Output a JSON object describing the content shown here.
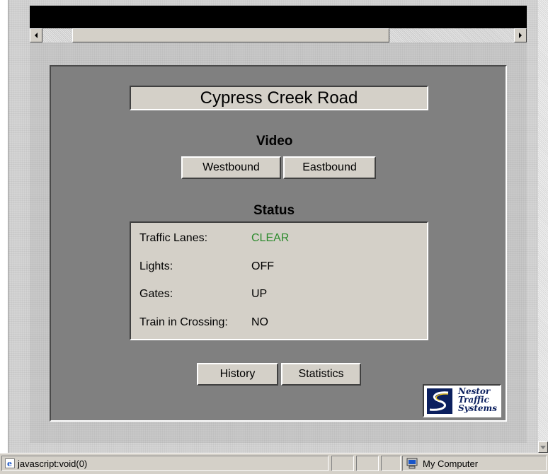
{
  "panel": {
    "title": "Cypress Creek Road",
    "video": {
      "heading": "Video",
      "westbound_label": "Westbound",
      "eastbound_label": "Eastbound"
    },
    "status": {
      "heading": "Status",
      "rows": [
        {
          "label": "Traffic Lanes:",
          "value": "CLEAR"
        },
        {
          "label": "Lights:",
          "value": "OFF"
        },
        {
          "label": "Gates:",
          "value": "UP"
        },
        {
          "label": "Train in Crossing:",
          "value": "NO"
        }
      ]
    },
    "history_label": "History",
    "statistics_label": "Statistics",
    "logo": {
      "line1": "Nestor",
      "line2": "Traffic",
      "line3": "Systems"
    }
  },
  "statusbar": {
    "url_text": "javascript:void(0)",
    "zone_text": "My Computer"
  },
  "colors": {
    "clear_status": "#2e8b2e",
    "panel_bg": "#808080",
    "box_bg": "#d4d0c8"
  }
}
